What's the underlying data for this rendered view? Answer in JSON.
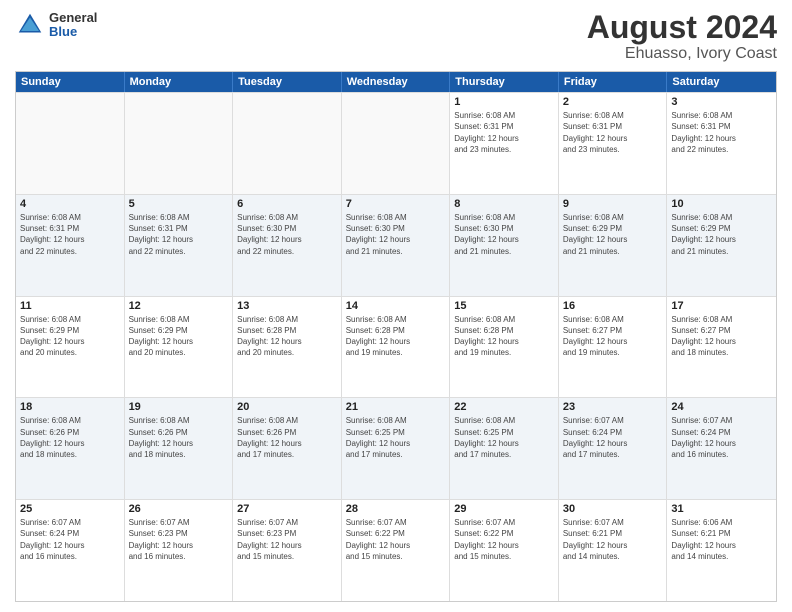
{
  "logo": {
    "line1": "General",
    "line2": "Blue"
  },
  "title": "August 2024",
  "subtitle": "Ehuasso, Ivory Coast",
  "days_of_week": [
    "Sunday",
    "Monday",
    "Tuesday",
    "Wednesday",
    "Thursday",
    "Friday",
    "Saturday"
  ],
  "rows": [
    [
      {
        "day": "",
        "info": "",
        "empty": true
      },
      {
        "day": "",
        "info": "",
        "empty": true
      },
      {
        "day": "",
        "info": "",
        "empty": true
      },
      {
        "day": "",
        "info": "",
        "empty": true
      },
      {
        "day": "1",
        "info": "Sunrise: 6:08 AM\nSunset: 6:31 PM\nDaylight: 12 hours\nand 23 minutes."
      },
      {
        "day": "2",
        "info": "Sunrise: 6:08 AM\nSunset: 6:31 PM\nDaylight: 12 hours\nand 23 minutes."
      },
      {
        "day": "3",
        "info": "Sunrise: 6:08 AM\nSunset: 6:31 PM\nDaylight: 12 hours\nand 22 minutes."
      }
    ],
    [
      {
        "day": "4",
        "info": "Sunrise: 6:08 AM\nSunset: 6:31 PM\nDaylight: 12 hours\nand 22 minutes."
      },
      {
        "day": "5",
        "info": "Sunrise: 6:08 AM\nSunset: 6:31 PM\nDaylight: 12 hours\nand 22 minutes."
      },
      {
        "day": "6",
        "info": "Sunrise: 6:08 AM\nSunset: 6:30 PM\nDaylight: 12 hours\nand 22 minutes."
      },
      {
        "day": "7",
        "info": "Sunrise: 6:08 AM\nSunset: 6:30 PM\nDaylight: 12 hours\nand 21 minutes."
      },
      {
        "day": "8",
        "info": "Sunrise: 6:08 AM\nSunset: 6:30 PM\nDaylight: 12 hours\nand 21 minutes."
      },
      {
        "day": "9",
        "info": "Sunrise: 6:08 AM\nSunset: 6:29 PM\nDaylight: 12 hours\nand 21 minutes."
      },
      {
        "day": "10",
        "info": "Sunrise: 6:08 AM\nSunset: 6:29 PM\nDaylight: 12 hours\nand 21 minutes."
      }
    ],
    [
      {
        "day": "11",
        "info": "Sunrise: 6:08 AM\nSunset: 6:29 PM\nDaylight: 12 hours\nand 20 minutes."
      },
      {
        "day": "12",
        "info": "Sunrise: 6:08 AM\nSunset: 6:29 PM\nDaylight: 12 hours\nand 20 minutes."
      },
      {
        "day": "13",
        "info": "Sunrise: 6:08 AM\nSunset: 6:28 PM\nDaylight: 12 hours\nand 20 minutes."
      },
      {
        "day": "14",
        "info": "Sunrise: 6:08 AM\nSunset: 6:28 PM\nDaylight: 12 hours\nand 19 minutes."
      },
      {
        "day": "15",
        "info": "Sunrise: 6:08 AM\nSunset: 6:28 PM\nDaylight: 12 hours\nand 19 minutes."
      },
      {
        "day": "16",
        "info": "Sunrise: 6:08 AM\nSunset: 6:27 PM\nDaylight: 12 hours\nand 19 minutes."
      },
      {
        "day": "17",
        "info": "Sunrise: 6:08 AM\nSunset: 6:27 PM\nDaylight: 12 hours\nand 18 minutes."
      }
    ],
    [
      {
        "day": "18",
        "info": "Sunrise: 6:08 AM\nSunset: 6:26 PM\nDaylight: 12 hours\nand 18 minutes."
      },
      {
        "day": "19",
        "info": "Sunrise: 6:08 AM\nSunset: 6:26 PM\nDaylight: 12 hours\nand 18 minutes."
      },
      {
        "day": "20",
        "info": "Sunrise: 6:08 AM\nSunset: 6:26 PM\nDaylight: 12 hours\nand 17 minutes."
      },
      {
        "day": "21",
        "info": "Sunrise: 6:08 AM\nSunset: 6:25 PM\nDaylight: 12 hours\nand 17 minutes."
      },
      {
        "day": "22",
        "info": "Sunrise: 6:08 AM\nSunset: 6:25 PM\nDaylight: 12 hours\nand 17 minutes."
      },
      {
        "day": "23",
        "info": "Sunrise: 6:07 AM\nSunset: 6:24 PM\nDaylight: 12 hours\nand 17 minutes."
      },
      {
        "day": "24",
        "info": "Sunrise: 6:07 AM\nSunset: 6:24 PM\nDaylight: 12 hours\nand 16 minutes."
      }
    ],
    [
      {
        "day": "25",
        "info": "Sunrise: 6:07 AM\nSunset: 6:24 PM\nDaylight: 12 hours\nand 16 minutes."
      },
      {
        "day": "26",
        "info": "Sunrise: 6:07 AM\nSunset: 6:23 PM\nDaylight: 12 hours\nand 16 minutes."
      },
      {
        "day": "27",
        "info": "Sunrise: 6:07 AM\nSunset: 6:23 PM\nDaylight: 12 hours\nand 15 minutes."
      },
      {
        "day": "28",
        "info": "Sunrise: 6:07 AM\nSunset: 6:22 PM\nDaylight: 12 hours\nand 15 minutes."
      },
      {
        "day": "29",
        "info": "Sunrise: 6:07 AM\nSunset: 6:22 PM\nDaylight: 12 hours\nand 15 minutes."
      },
      {
        "day": "30",
        "info": "Sunrise: 6:07 AM\nSunset: 6:21 PM\nDaylight: 12 hours\nand 14 minutes."
      },
      {
        "day": "31",
        "info": "Sunrise: 6:06 AM\nSunset: 6:21 PM\nDaylight: 12 hours\nand 14 minutes."
      }
    ]
  ]
}
